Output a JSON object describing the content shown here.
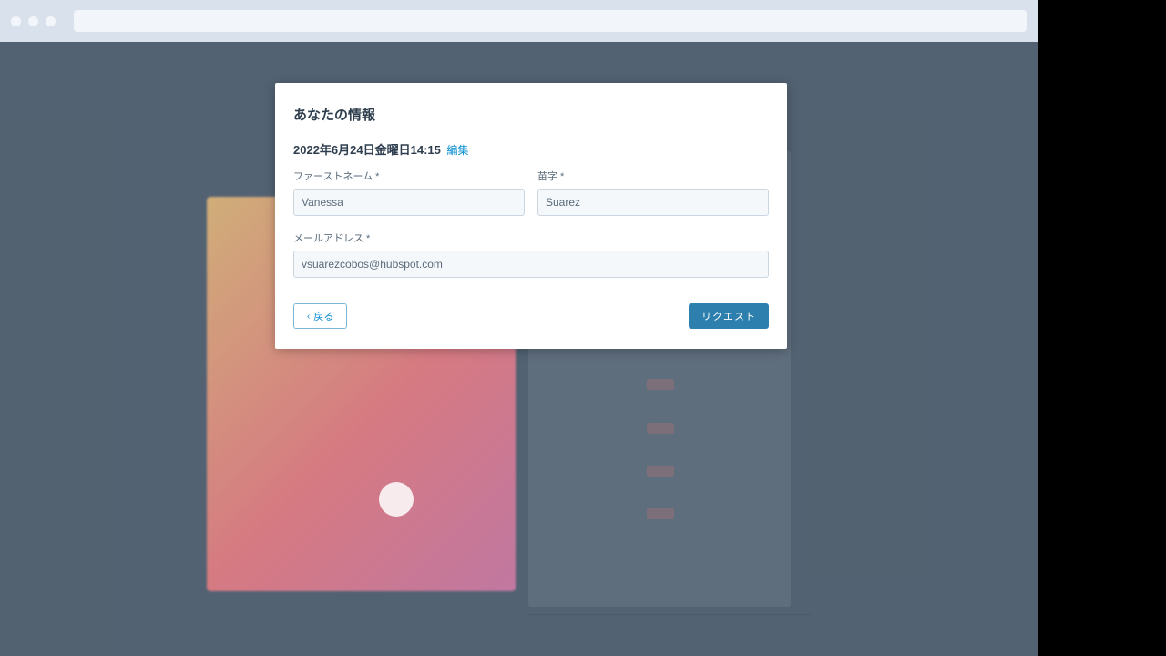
{
  "modal": {
    "title": "あなたの情報",
    "datetime": "2022年6月24日金曜日14:15",
    "edit_label": "編集",
    "first_name_label": "ファーストネーム *",
    "last_name_label": "苗字 *",
    "email_label": "メールアドレス *",
    "first_name_value": "Vanessa",
    "last_name_value": "Suarez",
    "email_value": "vsuarezcobos@hubspot.com",
    "back_label": "戻る",
    "submit_label": "リクエスト"
  }
}
